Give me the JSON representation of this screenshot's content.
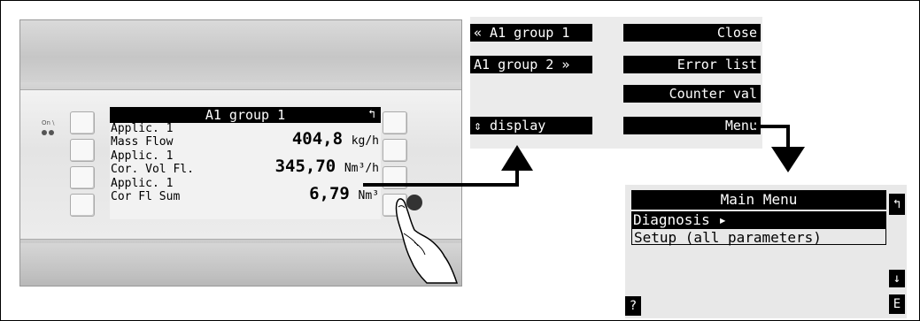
{
  "device": {
    "led_label": "On \\",
    "lcd": {
      "title": "A1 group 1",
      "back_icon": "↰",
      "rows": [
        {
          "applic": "Applic. 1",
          "name": "Mass Flow",
          "value": "404,8",
          "unit": "kg/h"
        },
        {
          "applic": "Applic. 1",
          "name": "Cor. Vol Fl.",
          "value": "345,70",
          "unit": "Nm³/h"
        },
        {
          "applic": "Applic. 1",
          "name": "Cor Fl Sum",
          "value": "6,79",
          "unit": "Nm³"
        }
      ]
    }
  },
  "softkeys": {
    "left": [
      "« A1 group 1",
      "A1 group 2 »",
      "",
      "⇕ display"
    ],
    "right": [
      "Close",
      "Error list",
      "Counter val",
      "Menu"
    ]
  },
  "main_menu": {
    "title": "Main Menu",
    "items": [
      "Diagnosis ▸",
      "Setup (all parameters)"
    ],
    "side_keys": {
      "top": "↰",
      "down": "↓",
      "enter": "E",
      "help": "?"
    }
  }
}
